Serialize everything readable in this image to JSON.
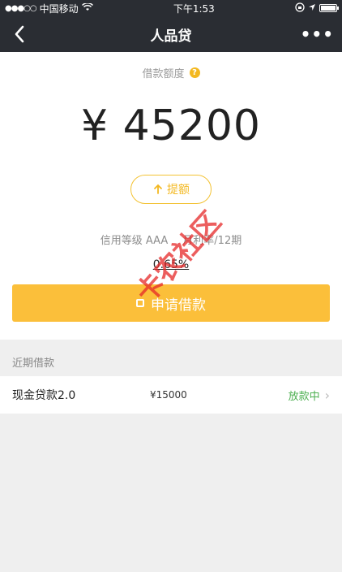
{
  "status_bar": {
    "signal": "●●●○○",
    "carrier": "中国移动",
    "time": "下午1:53",
    "icons": [
      "wifi-icon",
      "rotation-lock-icon",
      "location-arrow-icon",
      "battery-icon"
    ]
  },
  "nav": {
    "title": "人品贷",
    "back_icon": "chevron-left-icon",
    "more_label": "•••"
  },
  "credit": {
    "label": "借款额度",
    "help_symbol": "?",
    "amount": "¥ 45200",
    "withdraw_label": "提额",
    "withdraw_icon": "arrow-up-icon",
    "grade": "信用等级 AAA",
    "period_text": "月利率/12期",
    "rate": "0.65%",
    "apply_label": "申请借款"
  },
  "recent": {
    "header": "近期借款",
    "items": [
      {
        "name": "现金贷款2.0",
        "amount": "¥15000",
        "status": "放款中"
      }
    ]
  },
  "watermark": {
    "text": "卡农社区"
  },
  "colors": {
    "navbar": "#2a2d33",
    "accent": "#fbbf3a",
    "status_green": "#4caf50"
  }
}
